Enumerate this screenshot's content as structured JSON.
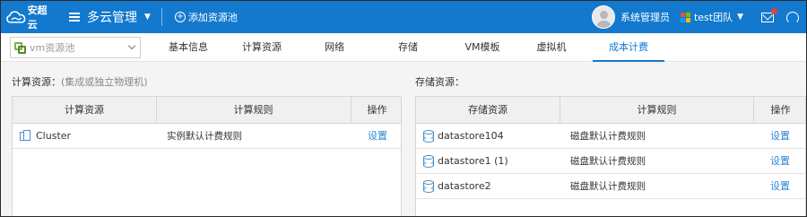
{
  "header": {
    "brand_text": "安超云",
    "app_title": "多云管理",
    "add_pool_label": "添加资源池",
    "user_name": "系统管理员",
    "team_name": "test团队",
    "colors": {
      "bar": "#1279ce",
      "notification_dot": "#e34234"
    }
  },
  "pool_selector": {
    "value": "vm资源池"
  },
  "tabs": [
    {
      "label": "基本信息",
      "active": false
    },
    {
      "label": "计算资源",
      "active": false
    },
    {
      "label": "网络",
      "active": false
    },
    {
      "label": "存储",
      "active": false
    },
    {
      "label": "VM模板",
      "active": false
    },
    {
      "label": "虚拟机",
      "active": false
    },
    {
      "label": "成本计费",
      "active": true
    }
  ],
  "compute": {
    "section_label": "计算资源：",
    "section_hint": "(集成或独立物理机)",
    "columns": [
      "计算资源",
      "计算规则",
      "操作"
    ],
    "rows": [
      {
        "name": "Cluster",
        "icon": "cluster-icon",
        "rule": "实例默认计费规则",
        "action": "设置"
      }
    ]
  },
  "storage": {
    "section_label": "存储资源：",
    "columns": [
      "存储资源",
      "计算规则",
      "操作"
    ],
    "rows": [
      {
        "name": "datastore104",
        "icon": "database-icon",
        "rule": "磁盘默认计费规则",
        "action": "设置"
      },
      {
        "name": "datastore1 (1)",
        "icon": "database-icon",
        "rule": "磁盘默认计费规则",
        "action": "设置"
      },
      {
        "name": "datastore2",
        "icon": "database-icon",
        "rule": "磁盘默认计费规则",
        "action": "设置"
      }
    ]
  }
}
